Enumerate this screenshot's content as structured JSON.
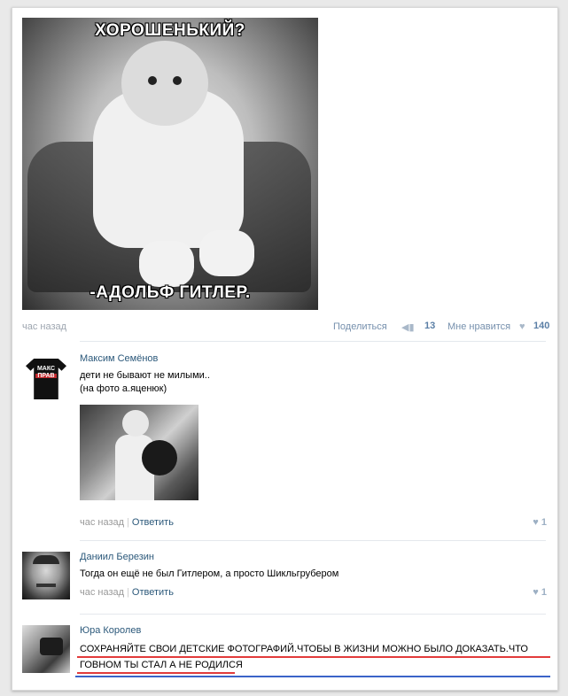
{
  "post": {
    "meme_top": "ХОРОШЕНЬКИЙ?",
    "meme_bottom": "-АДОЛЬФ ГИТЛЕР.",
    "time": "час назад",
    "share_label": "Поделиться",
    "share_count": "13",
    "like_label": "Мне нравится",
    "like_count": "140"
  },
  "comments": [
    {
      "author": "Максим Семёнов",
      "avatar_text": "МАКС ПРАВ",
      "line1": "дети не бывают не милыми..",
      "line2": "(на фото а.яценюк)",
      "time": "час назад",
      "reply": "Ответить",
      "likes": "1"
    },
    {
      "author": "Даниил Березин",
      "line1": "Тогда он ещё не был Гитлером, а просто Шикльгрубером",
      "time": "час назад",
      "reply": "Ответить",
      "likes": "1"
    },
    {
      "author": "Юра Королев",
      "line1": "СОХРАНЯЙТЕ СВОИ ДЕТСКИЕ ФОТОГРАФИЙ.ЧТОБЫ В ЖИЗНИ МОЖНО БЫЛО ДОКАЗАТЬ.ЧТО",
      "line2": "ГОВНОМ ТЫ СТАЛ А НЕ РОДИЛСЯ"
    }
  ],
  "colors": {
    "link": "#2b587a",
    "underline_red": "#e23b3b",
    "underline_blue": "#3b63c8"
  }
}
